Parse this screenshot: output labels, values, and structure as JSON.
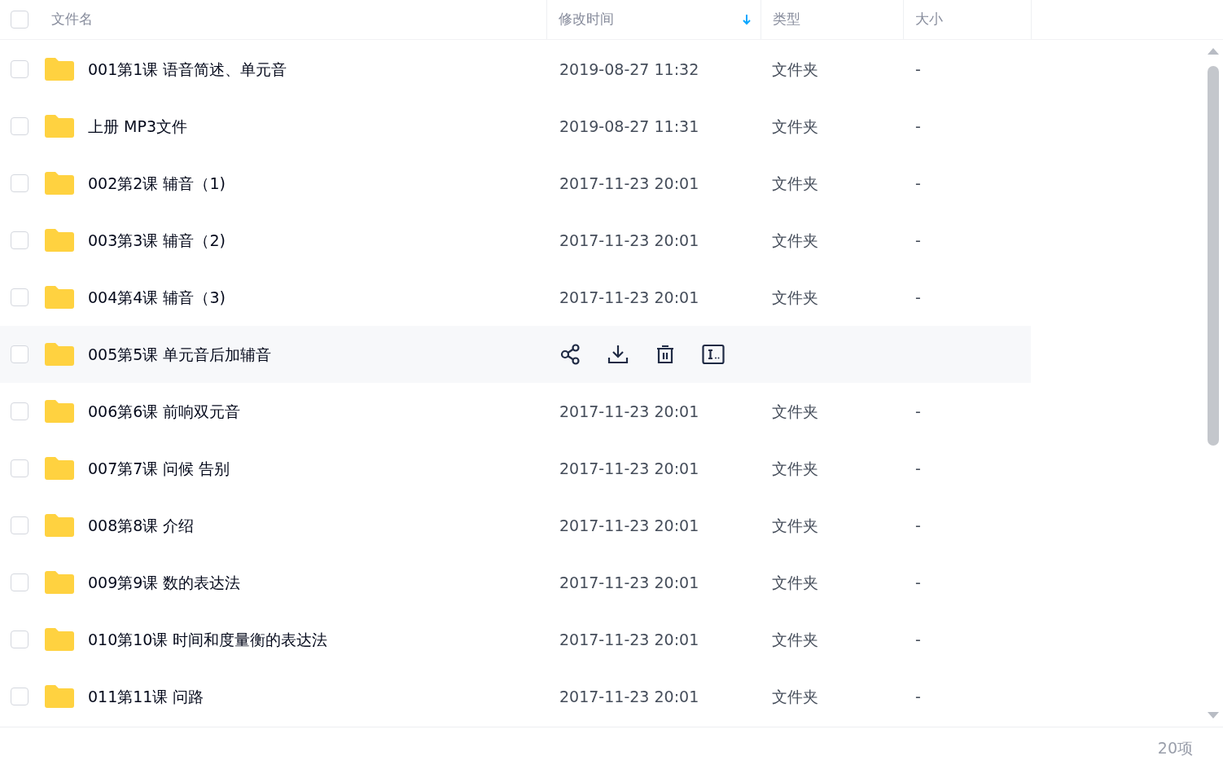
{
  "header": {
    "checked": false,
    "columns": [
      {
        "kind": "name",
        "label": "文件名",
        "sorted": false
      },
      {
        "kind": "time",
        "label": "修改时间",
        "sorted": true
      },
      {
        "kind": "type",
        "label": "类型",
        "sorted": false
      },
      {
        "kind": "size",
        "label": "大小",
        "sorted": false
      }
    ]
  },
  "rows": [
    {
      "name": "001第1课 语音简述、单元音",
      "time": "2019-08-27 11:32",
      "type": "文件夹",
      "size": "-",
      "checked": false,
      "hovered": false
    },
    {
      "name": "上册 MP3文件",
      "time": "2019-08-27 11:31",
      "type": "文件夹",
      "size": "-",
      "checked": false,
      "hovered": false
    },
    {
      "name": "002第2课 辅音（1)",
      "time": "2017-11-23 20:01",
      "type": "文件夹",
      "size": "-",
      "checked": false,
      "hovered": false
    },
    {
      "name": "003第3课 辅音（2)",
      "time": "2017-11-23 20:01",
      "type": "文件夹",
      "size": "-",
      "checked": false,
      "hovered": false
    },
    {
      "name": "004第4课 辅音（3)",
      "time": "2017-11-23 20:01",
      "type": "文件夹",
      "size": "-",
      "checked": false,
      "hovered": false
    },
    {
      "name": "005第5课 单元音后加辅音",
      "checked": false,
      "hovered": true
    },
    {
      "name": "006第6课 前响双元音",
      "time": "2017-11-23 20:01",
      "type": "文件夹",
      "size": "-",
      "checked": false,
      "hovered": false
    },
    {
      "name": "007第7课 问候 告别",
      "time": "2017-11-23 20:01",
      "type": "文件夹",
      "size": "-",
      "checked": false,
      "hovered": false
    },
    {
      "name": "008第8课 介绍",
      "time": "2017-11-23 20:01",
      "type": "文件夹",
      "size": "-",
      "checked": false,
      "hovered": false
    },
    {
      "name": "009第9课 数的表达法",
      "time": "2017-11-23 20:01",
      "type": "文件夹",
      "size": "-",
      "checked": false,
      "hovered": false
    },
    {
      "name": "010第10课 时间和度量衡的表达法",
      "time": "2017-11-23 20:01",
      "type": "文件夹",
      "size": "-",
      "checked": false,
      "hovered": false
    },
    {
      "name": "011第11课 问路",
      "time": "2017-11-23 20:01",
      "type": "文件夹",
      "size": "-",
      "checked": false,
      "hovered": false
    }
  ],
  "footer": {
    "count": "20项"
  }
}
